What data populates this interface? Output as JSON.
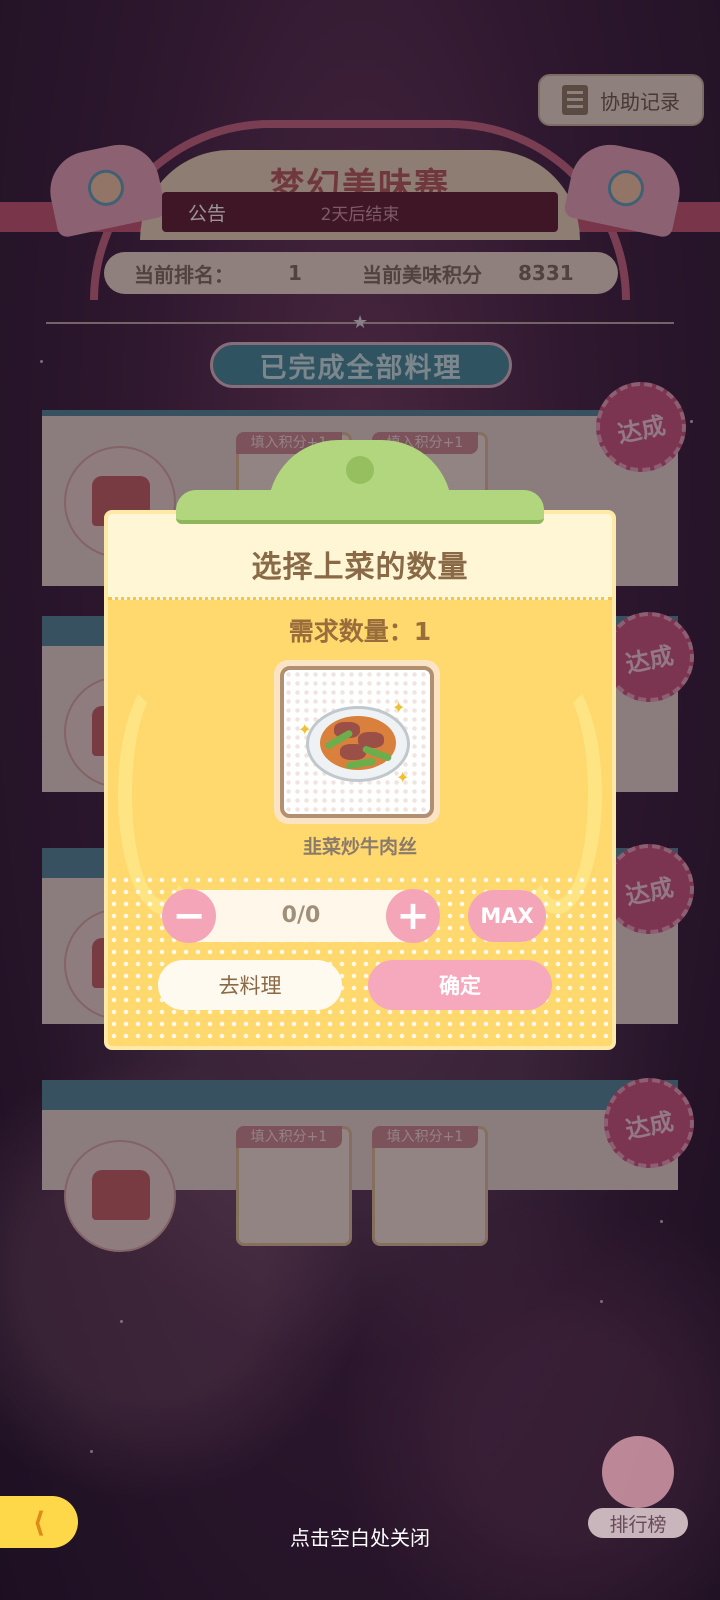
{
  "header": {
    "assist_record": "协助记录",
    "event_title": "梦幻美味赛",
    "announcement": "公告",
    "countdown": "2天后结束"
  },
  "rank_bar": {
    "rank_label": "当前排名：",
    "rank_value": "1",
    "score_label": "当前美味积分",
    "score_value": "8331"
  },
  "completed_banner": "已完成全部料理",
  "cards": {
    "tag_label": "填入积分+1",
    "achieved": "达成"
  },
  "modal": {
    "title": "选择上菜的数量",
    "need_label": "需求数量：1",
    "dish_name": "韭菜炒牛肉丝",
    "quantity": "0/0",
    "minus": "−",
    "plus": "+",
    "max": "MAX",
    "go_cook": "去料理",
    "confirm": "确定"
  },
  "footer": {
    "close_hint": "点击空白处关闭",
    "leaderboard": "排行榜"
  },
  "colors": {
    "modal_bg": "#ffd86e",
    "pink_button": "#f5a5b8",
    "clip_green": "#b2d67e"
  }
}
